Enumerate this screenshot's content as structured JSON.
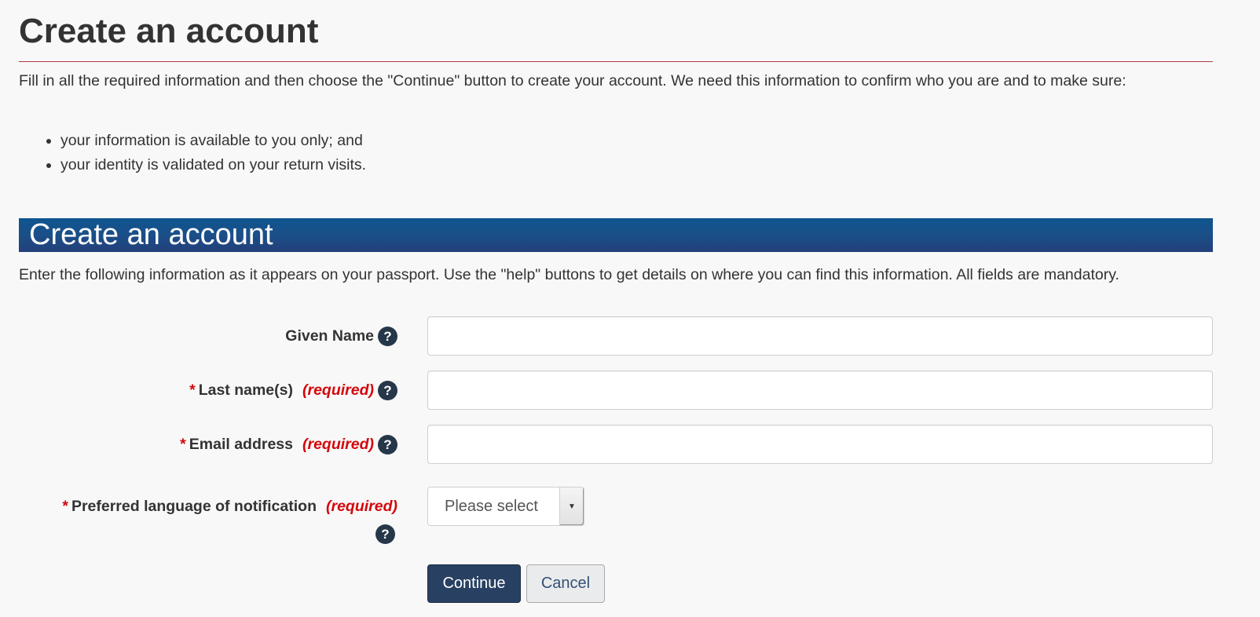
{
  "header": {
    "title": "Create an account",
    "intro": "Fill in all the required information and then choose the \"Continue\" button to create your account. We need this information to confirm who you are and to make sure:",
    "bullets": [
      "your information is available to you only; and",
      "your identity is validated on your return visits."
    ]
  },
  "section": {
    "title": "Create an account",
    "intro": "Enter the following information as it appears on your passport. Use the \"help\" buttons to get details on where you can find this information. All fields are mandatory."
  },
  "form": {
    "required_marker": "*",
    "required_text": "(required)",
    "help_glyph": "?",
    "fields": {
      "given_name": {
        "label": "Given Name",
        "value": ""
      },
      "last_name": {
        "label": "Last name(s)",
        "value": ""
      },
      "email": {
        "label": "Email address",
        "value": ""
      },
      "language": {
        "label": "Preferred language of notification",
        "selected": "Please select"
      }
    },
    "continue_label": "Continue",
    "cancel_label": "Cancel"
  },
  "colors": {
    "section_bar": "#1b4f88",
    "required": "#d3080c",
    "help_icon": "#26374a",
    "primary_button": "#284162",
    "title_rule": "#af3c43"
  }
}
